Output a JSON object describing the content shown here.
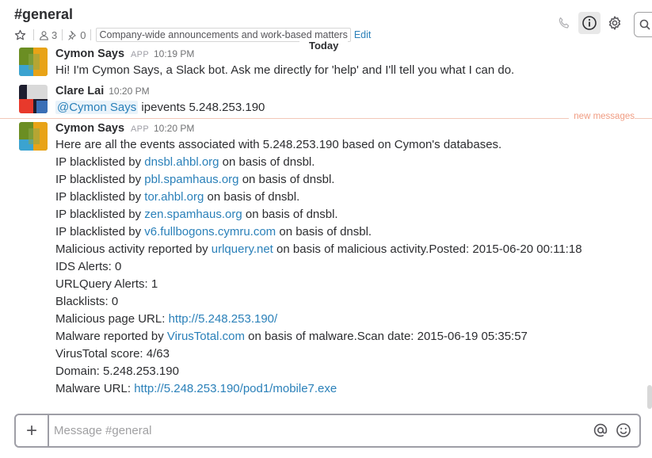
{
  "channel": {
    "name": "#general",
    "member_count": "3",
    "pinned_count": "0",
    "purpose": "Company-wide announcements and work-based matters",
    "edit_label": "Edit"
  },
  "icons": {
    "star": "star-icon",
    "members": "person-icon",
    "pins": "pin-icon",
    "call": "phone-icon",
    "info": "info-icon",
    "settings": "gear-icon",
    "search": "search-icon",
    "attach": "plus-icon",
    "mention": "at-icon",
    "emoji": "smiley-icon"
  },
  "colors": {
    "link": "#2a80b9",
    "new_messages": "#f09c82",
    "cymon_avatar": [
      "#6b8e23",
      "#e8a317",
      "#3ba3d0"
    ],
    "clare_avatar": [
      "#1e1e2f",
      "#d9d9d9",
      "#e8392b",
      "#3b6fb6"
    ]
  },
  "day_divider": "Today",
  "new_messages_label": "new messages",
  "messages": [
    {
      "sender": "Cymon Says",
      "app_tag": "APP",
      "time": "10:19 PM",
      "text": "Hi! I'm Cymon Says, a Slack bot. Ask me directly for 'help' and I'll tell you what I can do."
    },
    {
      "sender": "Clare Lai",
      "time": "10:20 PM",
      "mention": "@Cymon Says",
      "text": " ipevents 5.248.253.190"
    },
    {
      "sender": "Cymon Says",
      "app_tag": "APP",
      "time": "10:20 PM",
      "intro": "Here are all the events associated with 5.248.253.190 based on Cymon's databases.",
      "blacklists": [
        {
          "prefix": "IP blacklisted by ",
          "link": "dnsbl.ahbl.org",
          "suffix": " on basis of dnsbl."
        },
        {
          "prefix": "IP blacklisted by ",
          "link": "pbl.spamhaus.org",
          "suffix": " on basis of dnsbl."
        },
        {
          "prefix": "IP blacklisted by ",
          "link": "tor.ahbl.org",
          "suffix": " on basis of dnsbl."
        },
        {
          "prefix": "IP blacklisted by ",
          "link": "zen.spamhaus.org",
          "suffix": " on basis of dnsbl."
        },
        {
          "prefix": "IP blacklisted by ",
          "link": "v6.fullbogons.cymru.com",
          "suffix": " on basis of dnsbl."
        }
      ],
      "malicious": {
        "prefix": "Malicious activity reported by ",
        "link": "urlquery.net",
        "suffix": " on basis of malicious activity.Posted: 2015-06-20 00:11:18"
      },
      "ids_alerts": "IDS Alerts: 0",
      "urlquery_alerts": "URLQuery Alerts: 1",
      "blacklists_count": "Blacklists: 0",
      "malicious_page": {
        "prefix": "Malicious page URL: ",
        "link": "http://5.248.253.190/"
      },
      "malware": {
        "prefix": "Malware reported by ",
        "link": "VirusTotal.com",
        "suffix": " on basis of malware.Scan date: 2015-06-19 05:35:57"
      },
      "virustotal_score": "VirusTotal score: 4/63",
      "domain": "Domain: 5.248.253.190",
      "malware_url": {
        "prefix": "Malware URL: ",
        "link": "http://5.248.253.190/pod1/mobile7.exe"
      }
    }
  ],
  "composer": {
    "placeholder": "Message #general",
    "plus": "+"
  }
}
